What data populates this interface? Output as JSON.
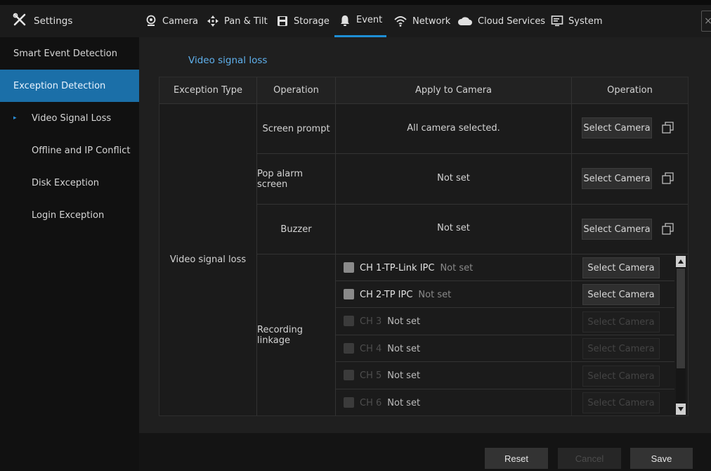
{
  "header": {
    "settings_label": "Settings",
    "tabs": [
      {
        "label": "Camera",
        "icon": "camera-icon"
      },
      {
        "label": "Pan & Tilt",
        "icon": "pan-tilt-icon"
      },
      {
        "label": "Storage",
        "icon": "storage-icon"
      },
      {
        "label": "Event",
        "icon": "bell-icon",
        "active": true
      },
      {
        "label": "Network",
        "icon": "wifi-icon"
      },
      {
        "label": "Cloud Services",
        "icon": "cloud-icon"
      },
      {
        "label": "System",
        "icon": "monitor-icon"
      }
    ],
    "close_glyph": "×"
  },
  "sidebar": {
    "items": [
      {
        "label": "Smart Event Detection",
        "level": "top"
      },
      {
        "label": "Exception Detection",
        "level": "top",
        "active": true
      },
      {
        "label": "Video Signal Loss",
        "level": "sub",
        "current": true
      },
      {
        "label": "Offline and IP Conflict",
        "level": "sub"
      },
      {
        "label": "Disk Exception",
        "level": "sub"
      },
      {
        "label": "Login Exception",
        "level": "sub"
      }
    ]
  },
  "main": {
    "section_title": "Video signal loss",
    "table": {
      "headers": [
        "Exception Type",
        "Operation",
        "Apply to Camera",
        "Operation"
      ],
      "exception_type": "Video signal loss",
      "operations": [
        {
          "name": "Screen prompt",
          "apply": "All camera selected.",
          "button": "Select Camera"
        },
        {
          "name": "Pop alarm screen",
          "apply": "Not set",
          "button": "Select Camera"
        },
        {
          "name": "Buzzer",
          "apply": "Not set",
          "button": "Select Camera"
        }
      ],
      "recording": {
        "name": "Recording linkage",
        "channels": [
          {
            "name": "CH 1-TP-Link IPC",
            "status": "Not set",
            "button": "Select Camera",
            "enabled": true
          },
          {
            "name": "CH 2-TP IPC",
            "status": "Not set",
            "button": "Select Camera",
            "enabled": true
          },
          {
            "name": "CH 3",
            "status": "Not set",
            "button": "Select Camera",
            "enabled": false
          },
          {
            "name": "CH 4",
            "status": "Not set",
            "button": "Select Camera",
            "enabled": false
          },
          {
            "name": "CH 5",
            "status": "Not set",
            "button": "Select Camera",
            "enabled": false
          },
          {
            "name": "CH 6",
            "status": "Not set",
            "button": "Select Camera",
            "enabled": false
          }
        ]
      }
    }
  },
  "footer": {
    "reset_label": "Reset",
    "cancel_label": "Cancel",
    "save_label": "Save"
  },
  "colors": {
    "accent": "#1e8fd6",
    "sidebar_active": "#1b6fa8",
    "link": "#5fb0ec"
  }
}
